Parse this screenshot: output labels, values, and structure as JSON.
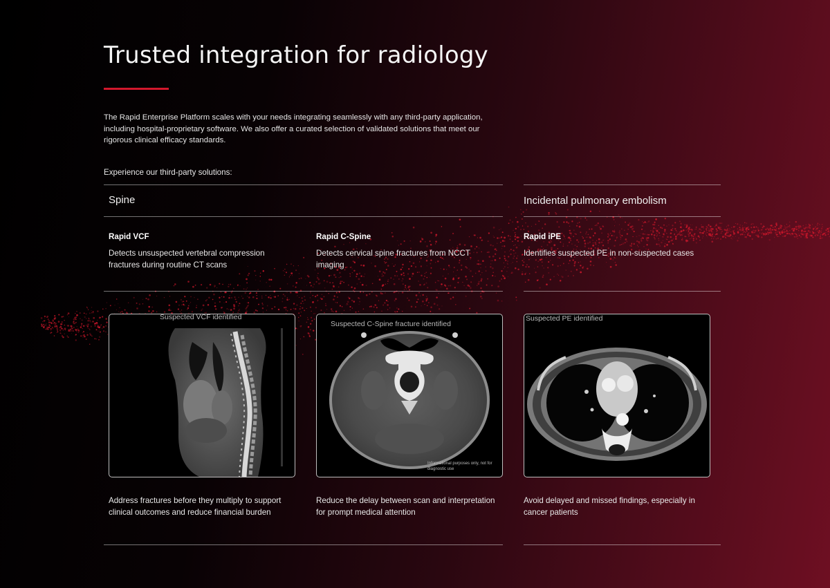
{
  "page": {
    "title": "Trusted integration for radiology",
    "intro": "The Rapid Enterprise Platform scales with your needs integrating seamlessly with any third-party application, including hospital-proprietary software. We also offer a curated selection of validated solutions that meet our rigorous clinical efficacy standards.",
    "subheading": "Experience our third-party solutions:"
  },
  "colors": {
    "accent": "#d3182c",
    "background_dark": "#000000",
    "background_red": "#6e0f22"
  },
  "categories": [
    {
      "label": "Spine"
    },
    {
      "label": "Incidental pulmonary embolism"
    }
  ],
  "products": [
    {
      "name": "Rapid VCF",
      "description": "Detects unsuspected vertebral compression fractures during routine CT scans",
      "scan_label": "Suspected VCF identified",
      "scan_icon": "sagittal-spine-ct-image",
      "benefit": "Address fractures before they multiply to support clinical outcomes and reduce financial burden"
    },
    {
      "name": "Rapid C-Spine",
      "description": "Detects cervical spine fractures from NCCT imaging",
      "scan_label": "Suspected C-Spine fracture identified",
      "scan_note": "Informational purposes only, not for diagnostic use",
      "scan_icon": "axial-neck-ct-image",
      "benefit": "Reduce the delay between scan and interpretation for prompt medical attention"
    },
    {
      "name": "Rapid iPE",
      "description": "Identifies suspected PE in non-suspected cases",
      "scan_label": "Suspected PE identified",
      "scan_icon": "axial-chest-ct-image",
      "benefit": "Avoid delayed and missed findings, especially in cancer patients"
    }
  ]
}
